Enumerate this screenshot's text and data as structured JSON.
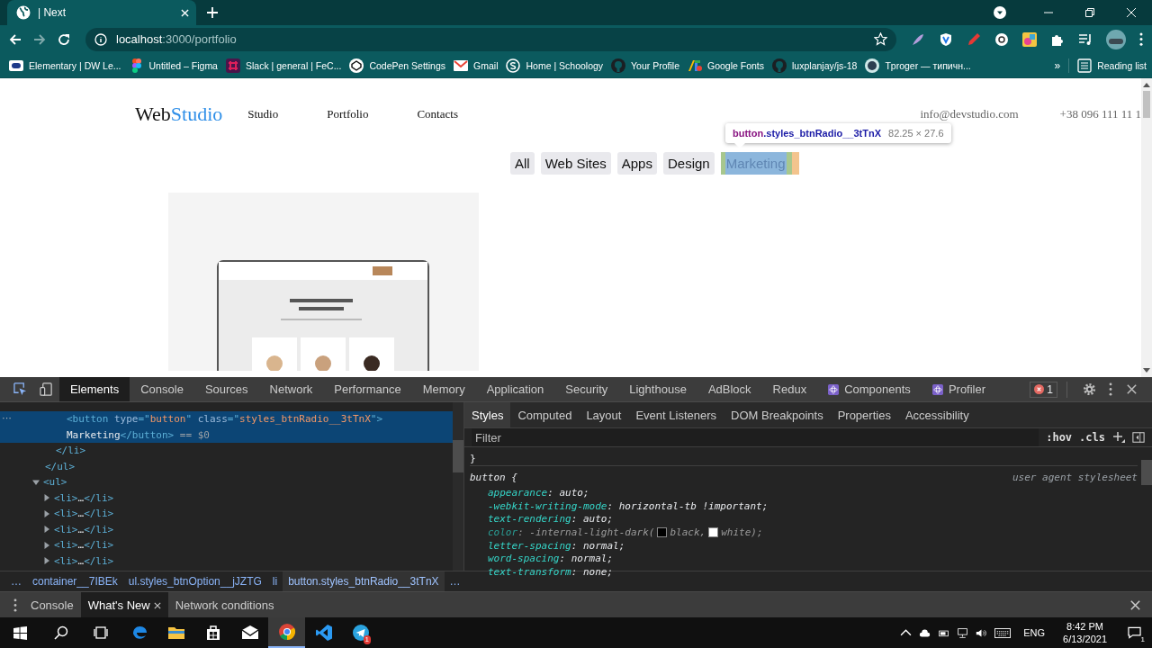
{
  "browser": {
    "tabs": [
      {
        "title": "| Next",
        "selected": true
      }
    ],
    "address": {
      "host": "localhost",
      "path": ":3000/portfolio"
    },
    "bookmarks": [
      {
        "label": "Elementary | DW Le...",
        "kind": "dw"
      },
      {
        "label": "Untitled – Figma",
        "kind": "figma"
      },
      {
        "label": "Slack | general | FeC...",
        "kind": "slack"
      },
      {
        "label": "CodePen Settings",
        "kind": "codepen"
      },
      {
        "label": "Gmail",
        "kind": "gmail"
      },
      {
        "label": "Home | Schoology",
        "kind": "schoology"
      },
      {
        "label": "Your Profile",
        "kind": "github"
      },
      {
        "label": "Google Fonts",
        "kind": "gfonts"
      },
      {
        "label": "luxplanjay/js-18",
        "kind": "github"
      },
      {
        "label": "Tproger — типичн...",
        "kind": "tproger"
      }
    ],
    "more_bookmarks": "»",
    "reading_list": "Reading list"
  },
  "page": {
    "logo": {
      "first": "Web",
      "second": "Studio"
    },
    "nav": [
      {
        "label": "Studio"
      },
      {
        "label": "Portfolio"
      },
      {
        "label": "Contacts"
      }
    ],
    "email": "info@devstudio.com",
    "phone": "+38 096 111 11 1",
    "filters": [
      {
        "label": "All",
        "highlighted": false
      },
      {
        "label": "Web Sites",
        "highlighted": false
      },
      {
        "label": "Apps",
        "highlighted": false
      },
      {
        "label": "Design",
        "highlighted": false
      },
      {
        "label": "Marketing",
        "highlighted": true
      }
    ],
    "inspect_tooltip": {
      "tag": "button",
      "class": ".styles_btnRadio__3tTnX",
      "size": "82.25 × 27.6"
    }
  },
  "devtools": {
    "tabs": [
      {
        "label": "Elements",
        "selected": true
      },
      {
        "label": "Console",
        "selected": false
      },
      {
        "label": "Sources",
        "selected": false
      },
      {
        "label": "Network",
        "selected": false
      },
      {
        "label": "Performance",
        "selected": false
      },
      {
        "label": "Memory",
        "selected": false
      },
      {
        "label": "Application",
        "selected": false
      },
      {
        "label": "Security",
        "selected": false
      },
      {
        "label": "Lighthouse",
        "selected": false
      },
      {
        "label": "AdBlock",
        "selected": false
      },
      {
        "label": "Redux",
        "selected": false
      },
      {
        "label": "Components",
        "selected": false,
        "kind": "react"
      },
      {
        "label": "Profiler",
        "selected": false,
        "kind": "react"
      }
    ],
    "error_count": "1",
    "gutter": "···",
    "dom_tree": [
      {
        "closing": [
          {
            "text": "</ul>",
            "kind": "tag"
          }
        ],
        "children": [
          {
            "closing": [
              {
                "text": "</li>",
                "kind": "tag"
              }
            ],
            "children": [
              {
                "selected": true,
                "open": [
                  {
                    "text": "<button",
                    "kind": "tag"
                  },
                  {
                    "text": " type",
                    "kind": "attr"
                  },
                  {
                    "text": "=\"",
                    "kind": "tag"
                  },
                  {
                    "text": "button",
                    "kind": "value"
                  },
                  {
                    "text": "\"",
                    "kind": "tag"
                  },
                  {
                    "text": " class",
                    "kind": "attr"
                  },
                  {
                    "text": "=\"",
                    "kind": "tag"
                  },
                  {
                    "text": "styles_btnRadio__3tTnX",
                    "kind": "value"
                  },
                  {
                    "text": "\">",
                    "kind": "tag"
                  }
                ],
                "open_more": [
                  {
                    "text": "Marketing",
                    "kind": "text"
                  },
                  {
                    "text": "</button>",
                    "kind": "tag"
                  },
                  {
                    "text": " == $0",
                    "kind": "note"
                  }
                ]
              }
            ]
          }
        ]
      },
      {
        "expanded": true,
        "open": [
          {
            "text": "<ul>",
            "kind": "tag"
          }
        ],
        "children": [
          {
            "expanded": false,
            "open": [
              {
                "text": "<li>",
                "kind": "tag"
              },
              {
                "text": "…",
                "kind": "text"
              },
              {
                "text": "</li>",
                "kind": "tag"
              }
            ]
          },
          {
            "expanded": false,
            "open": [
              {
                "text": "<li>",
                "kind": "tag"
              },
              {
                "text": "…",
                "kind": "text"
              },
              {
                "text": "</li>",
                "kind": "tag"
              }
            ]
          },
          {
            "expanded": false,
            "open": [
              {
                "text": "<li>",
                "kind": "tag"
              },
              {
                "text": "…",
                "kind": "text"
              },
              {
                "text": "</li>",
                "kind": "tag"
              }
            ]
          },
          {
            "expanded": false,
            "open": [
              {
                "text": "<li>",
                "kind": "tag"
              },
              {
                "text": "…",
                "kind": "text"
              },
              {
                "text": "</li>",
                "kind": "tag"
              }
            ]
          },
          {
            "expanded": false,
            "open": [
              {
                "text": "<li>",
                "kind": "tag"
              },
              {
                "text": "…",
                "kind": "text"
              },
              {
                "text": "</li>",
                "kind": "tag"
              }
            ]
          }
        ]
      }
    ],
    "breadcrumbs": [
      {
        "label": "…",
        "selected": false
      },
      {
        "label": "container__7IBEk",
        "selected": false
      },
      {
        "label": "ul.styles_btnOption__jJZTG",
        "selected": false
      },
      {
        "label": "li",
        "selected": false
      },
      {
        "label": "button.styles_btnRadio__3tTnX",
        "selected": true
      },
      {
        "label": "…",
        "selected": false
      }
    ],
    "style_tabs": [
      {
        "label": "Styles",
        "selected": true
      },
      {
        "label": "Computed",
        "selected": false
      },
      {
        "label": "Layout",
        "selected": false
      },
      {
        "label": "Event Listeners",
        "selected": false
      },
      {
        "label": "DOM Breakpoints",
        "selected": false
      },
      {
        "label": "Properties",
        "selected": false
      },
      {
        "label": "Accessibility",
        "selected": false
      }
    ],
    "filter": {
      "placeholder": "Filter"
    },
    "hov": ":hov",
    "cls": ".cls",
    "prev_rule_end": "}",
    "rule": {
      "selector": "button {",
      "origin": "user agent stylesheet",
      "props": [
        {
          "name": "appearance",
          "value": [
            {
              "text": ": auto;"
            }
          ],
          "overridden": false
        },
        {
          "name": "-webkit-writing-mode",
          "value": [
            {
              "text": ": horizontal-tb !important;"
            }
          ],
          "overridden": false
        },
        {
          "name": "text-rendering",
          "value": [
            {
              "text": ": auto;"
            }
          ],
          "overridden": false
        },
        {
          "name": "color",
          "value": [
            {
              "text": ": -internal-light-dark("
            },
            {
              "text": "black,",
              "color": "#000000"
            },
            {
              "text": "white);",
              "color": "#ffffff"
            }
          ],
          "overridden": true
        },
        {
          "name": "letter-spacing",
          "value": [
            {
              "text": ": normal;"
            }
          ],
          "overridden": false
        },
        {
          "name": "word-spacing",
          "value": [
            {
              "text": ": normal;"
            }
          ],
          "overridden": false
        },
        {
          "name": "text-transform",
          "value": [
            {
              "text": ": none;"
            }
          ],
          "overridden": false
        }
      ]
    },
    "drawer_tabs": [
      {
        "label": "Console",
        "selected": false,
        "closable": false
      },
      {
        "label": "What's New",
        "selected": true,
        "closable": true
      },
      {
        "label": "Network conditions",
        "selected": false,
        "closable": false
      }
    ]
  },
  "taskbar": {
    "apps": [
      {
        "kind": "edge",
        "active": false
      },
      {
        "kind": "explorer",
        "active": false
      },
      {
        "kind": "store",
        "active": false
      },
      {
        "kind": "mail",
        "active": false
      },
      {
        "kind": "chrome",
        "active": true
      },
      {
        "kind": "vscode",
        "active": false
      },
      {
        "kind": "telegram",
        "active": false,
        "badge": "1"
      }
    ],
    "language": "ENG",
    "time": "8:42 PM",
    "date": "6/13/2021",
    "notifications": "1"
  }
}
